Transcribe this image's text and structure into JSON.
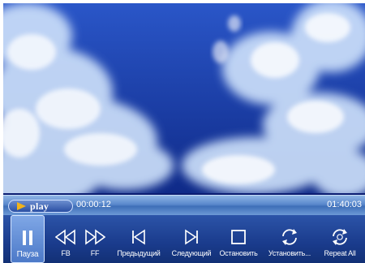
{
  "player": {
    "state_label": "play",
    "elapsed_time": "00:00:12",
    "total_time": "01:40:03",
    "progress_fraction": 0.002
  },
  "controls": {
    "pause": "Пауза",
    "rewind": "FB",
    "fast_forward": "FF",
    "previous": "Предыдущий",
    "next": "Следующий",
    "stop": "Остановить",
    "setup": "Установить...",
    "repeat": "Repeat All"
  },
  "icons": {
    "pause": "pause-icon",
    "rewind": "rewind-icon",
    "fast_forward": "fast-forward-icon",
    "previous": "skip-previous-icon",
    "next": "skip-next-icon",
    "stop": "stop-icon",
    "setup": "refresh-arrows-icon",
    "repeat": "repeat-icon"
  },
  "colors": {
    "panel": "#1a3b8c",
    "play_indicator": "#f2b31a",
    "sky": "#13308f"
  }
}
